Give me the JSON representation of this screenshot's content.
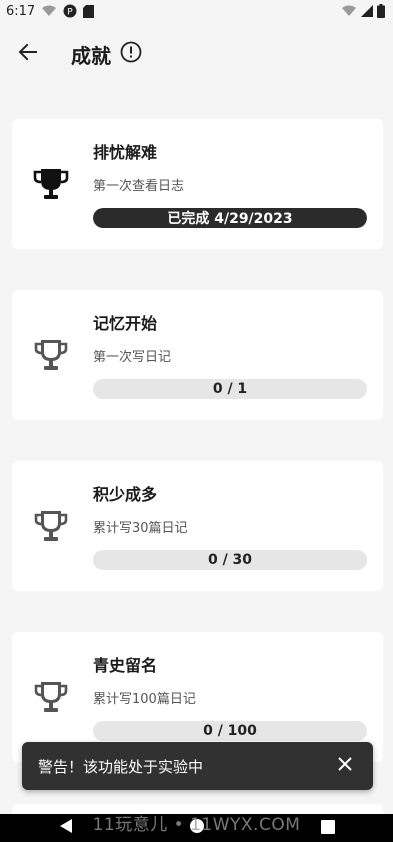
{
  "status_bar": {
    "time": "6:17",
    "left_icons": [
      "wifi-calling-icon",
      "vpn-icon",
      "sd-card-icon"
    ],
    "right_icons": [
      "wifi-icon",
      "signal-icon",
      "battery-icon"
    ]
  },
  "app_bar": {
    "back_icon": "arrow-left-icon",
    "title": "成就",
    "info_icon": "info-circle-icon"
  },
  "achievements": [
    {
      "name": "排忧解难",
      "description": "第一次查看日志",
      "progress_text": "已完成 4/29/2023",
      "progress": 1.0,
      "completed": true
    },
    {
      "name": "记忆开始",
      "description": "第一次写日记",
      "progress_text": "0 / 1",
      "progress": 0,
      "completed": false
    },
    {
      "name": "积少成多",
      "description": "累计写30篇日记",
      "progress_text": "0 / 30",
      "progress": 0,
      "completed": false
    },
    {
      "name": "青史留名",
      "description": "累计写100篇日记",
      "progress_text": "0 / 100",
      "progress": 0,
      "completed": false
    }
  ],
  "snackbar": {
    "message": "警告！该功能处于实验中",
    "close_icon": "close-icon"
  },
  "watermark": "11玩意儿 • 11WYX.COM",
  "colors": {
    "background": "#f5f5f5",
    "card": "#ffffff",
    "trophy_done": "#111111",
    "trophy_pending": "#555555",
    "progress_fill": "#2b2b2b",
    "progress_track": "#e6e6e6",
    "snackbar": "#313131"
  }
}
